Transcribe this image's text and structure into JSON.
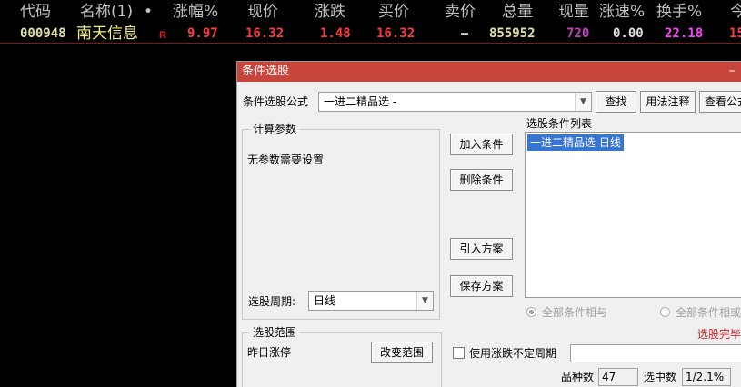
{
  "quote_table": {
    "headers": [
      "代码",
      "名称(1)",
      "•",
      "涨幅%",
      "现价",
      "涨跌",
      "买价",
      "卖价",
      "总量",
      "现量",
      "涨速%",
      "换手%",
      "今"
    ],
    "row": {
      "code": "000948",
      "name": "南天信息",
      "flag": "R",
      "change_pct": "9.97",
      "price": "16.32",
      "change": "1.48",
      "bid": "16.32",
      "ask": "–",
      "volume": "855952",
      "last_volume": "720",
      "speed_pct": "0.00",
      "turnover_pct": "22.18",
      "today_open": "15"
    },
    "colors": {
      "header": "#c0c0c0",
      "code": "#e0e0a0",
      "name": "#f0f080",
      "flag": "#e02020",
      "up": "#ff3c3c",
      "neutral": "#e0e0e0",
      "volume": "#e0e0a0",
      "last_volume": "#c040c0",
      "turnover": "#ff40ff"
    }
  },
  "dialog": {
    "title": "条件选股",
    "minimize_symbol": "–",
    "formula_label": "条件选股公式",
    "formula_value": "一进二精品选  -",
    "find_button": "查找",
    "usage_button": "用法注释",
    "view_formula_button": "查看公式",
    "params_group_title": "计算参数",
    "params_text": "无参数需要设置",
    "period_label": "选股周期:",
    "period_value": "日线",
    "add_condition_button": "加入条件",
    "delete_condition_button": "删除条件",
    "import_plan_button": "引入方案",
    "save_plan_button": "保存方案",
    "condition_list_label": "选股条件列表",
    "condition_items": [
      "一进二精品选  日线"
    ],
    "radio_and_label": "全部条件相与",
    "radio_or_label": "全部条件相或",
    "status_text": "选股完毕",
    "range_group_title": "选股范围",
    "range_value": "昨日涨停",
    "change_range_button": "改变范围",
    "indeterminate_period_label": "使用涨跌不定周期",
    "stock_count_label": "品种数",
    "stock_count_value": "47",
    "selected_count_label": "选中数",
    "selected_count_value": "1/2.1%"
  }
}
